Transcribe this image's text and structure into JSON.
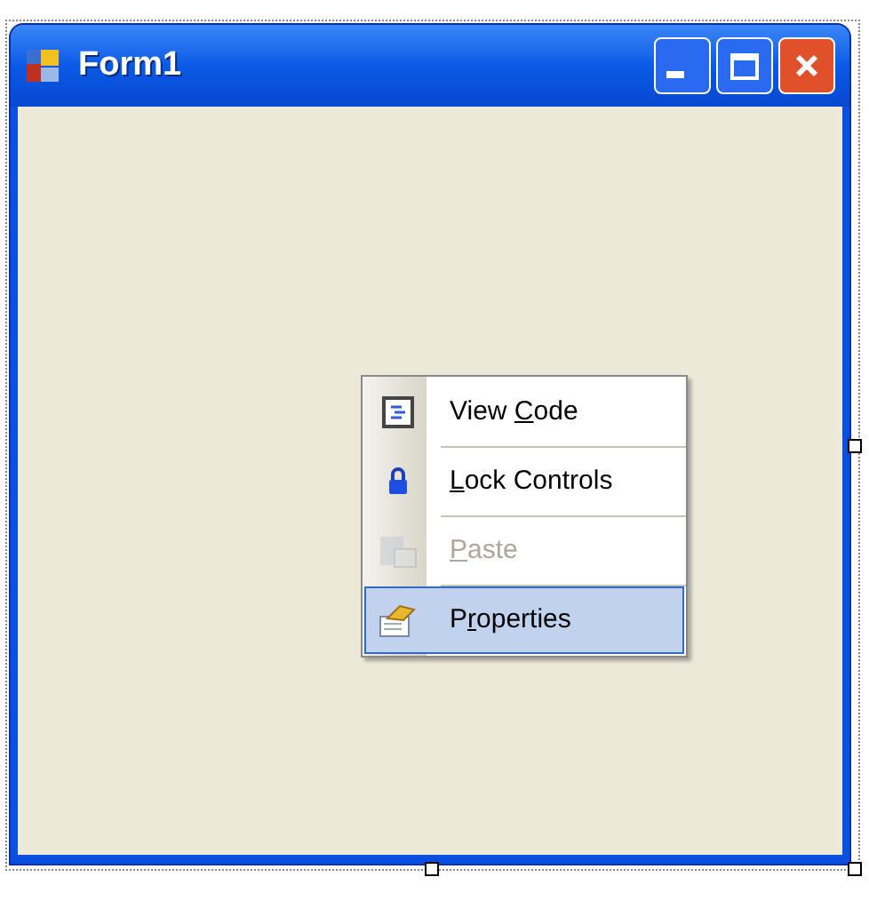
{
  "window": {
    "title": "Form1",
    "controls": [
      {
        "kind": "minimize"
      },
      {
        "kind": "maximize"
      },
      {
        "kind": "close"
      }
    ]
  },
  "context_menu": {
    "items": [
      {
        "kind": "code",
        "label_before": "View ",
        "mnemonic": "C",
        "label_after": "ode",
        "disabled": false,
        "selected": false
      },
      {
        "kind": "lock",
        "mnemonic": "L",
        "label_after": "ock Controls",
        "disabled": false,
        "selected": false
      },
      {
        "kind": "paste",
        "mnemonic": "P",
        "label_after": "aste",
        "disabled": true,
        "selected": false
      },
      {
        "kind": "properties",
        "label_before": "P",
        "mnemonic": "r",
        "label_after": "operties",
        "disabled": false,
        "selected": true
      }
    ]
  }
}
